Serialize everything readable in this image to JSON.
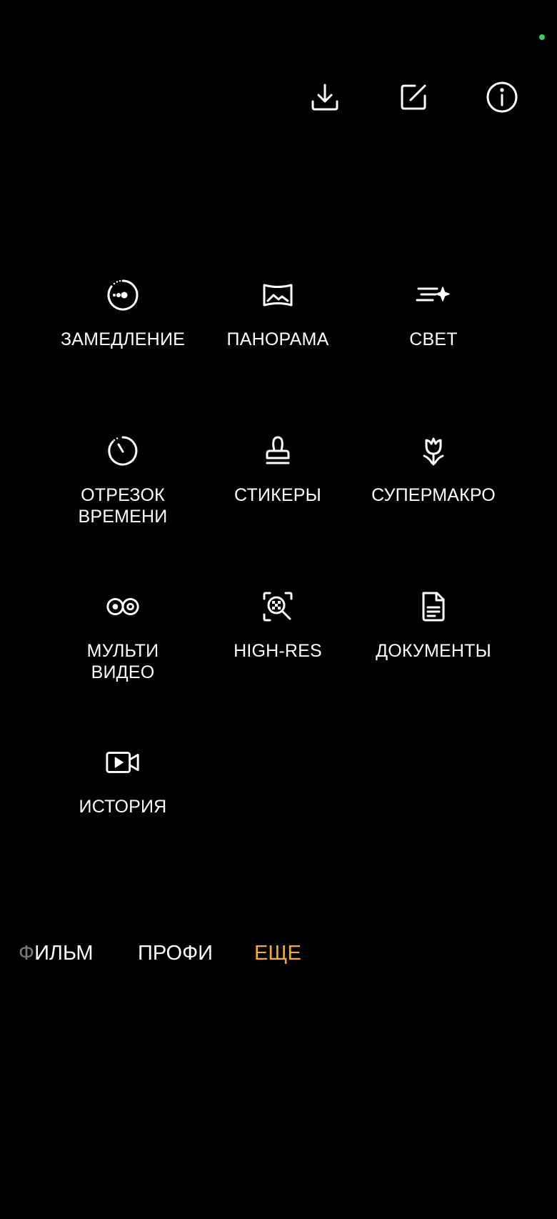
{
  "colors": {
    "background": "#000000",
    "text": "#ffffff",
    "accent": "#f2a93b",
    "status_dot": "#3cc864"
  },
  "top_actions": [
    {
      "icon": "download-icon"
    },
    {
      "icon": "edit-icon"
    },
    {
      "icon": "info-icon"
    }
  ],
  "modes": [
    {
      "label": "ЗАМЕДЛЕНИЕ",
      "icon": "slow-motion-icon"
    },
    {
      "label": "ПАНОРАМА",
      "icon": "panorama-icon"
    },
    {
      "label": "СВЕТ",
      "icon": "light-trails-icon"
    },
    {
      "label": "ОТРЕЗОК\nВРЕМЕНИ",
      "icon": "timelapse-icon"
    },
    {
      "label": "СТИКЕРЫ",
      "icon": "stamp-icon"
    },
    {
      "label": "СУПЕРМАКРО",
      "icon": "macro-flower-icon"
    },
    {
      "label": "МУЛЬТИ\nВИДЕО",
      "icon": "multi-video-icon"
    },
    {
      "label": "HIGH-RES",
      "icon": "high-res-icon"
    },
    {
      "label": "ДОКУМЕНТЫ",
      "icon": "document-icon"
    },
    {
      "label": "ИСТОРИЯ",
      "icon": "story-video-icon"
    }
  ],
  "mode_bar": {
    "film_fade": "Ф",
    "film_rest": "ИЛЬМ",
    "pro": "ПРОФИ",
    "more": "ЕЩЕ",
    "selected": "ЕЩЕ"
  }
}
